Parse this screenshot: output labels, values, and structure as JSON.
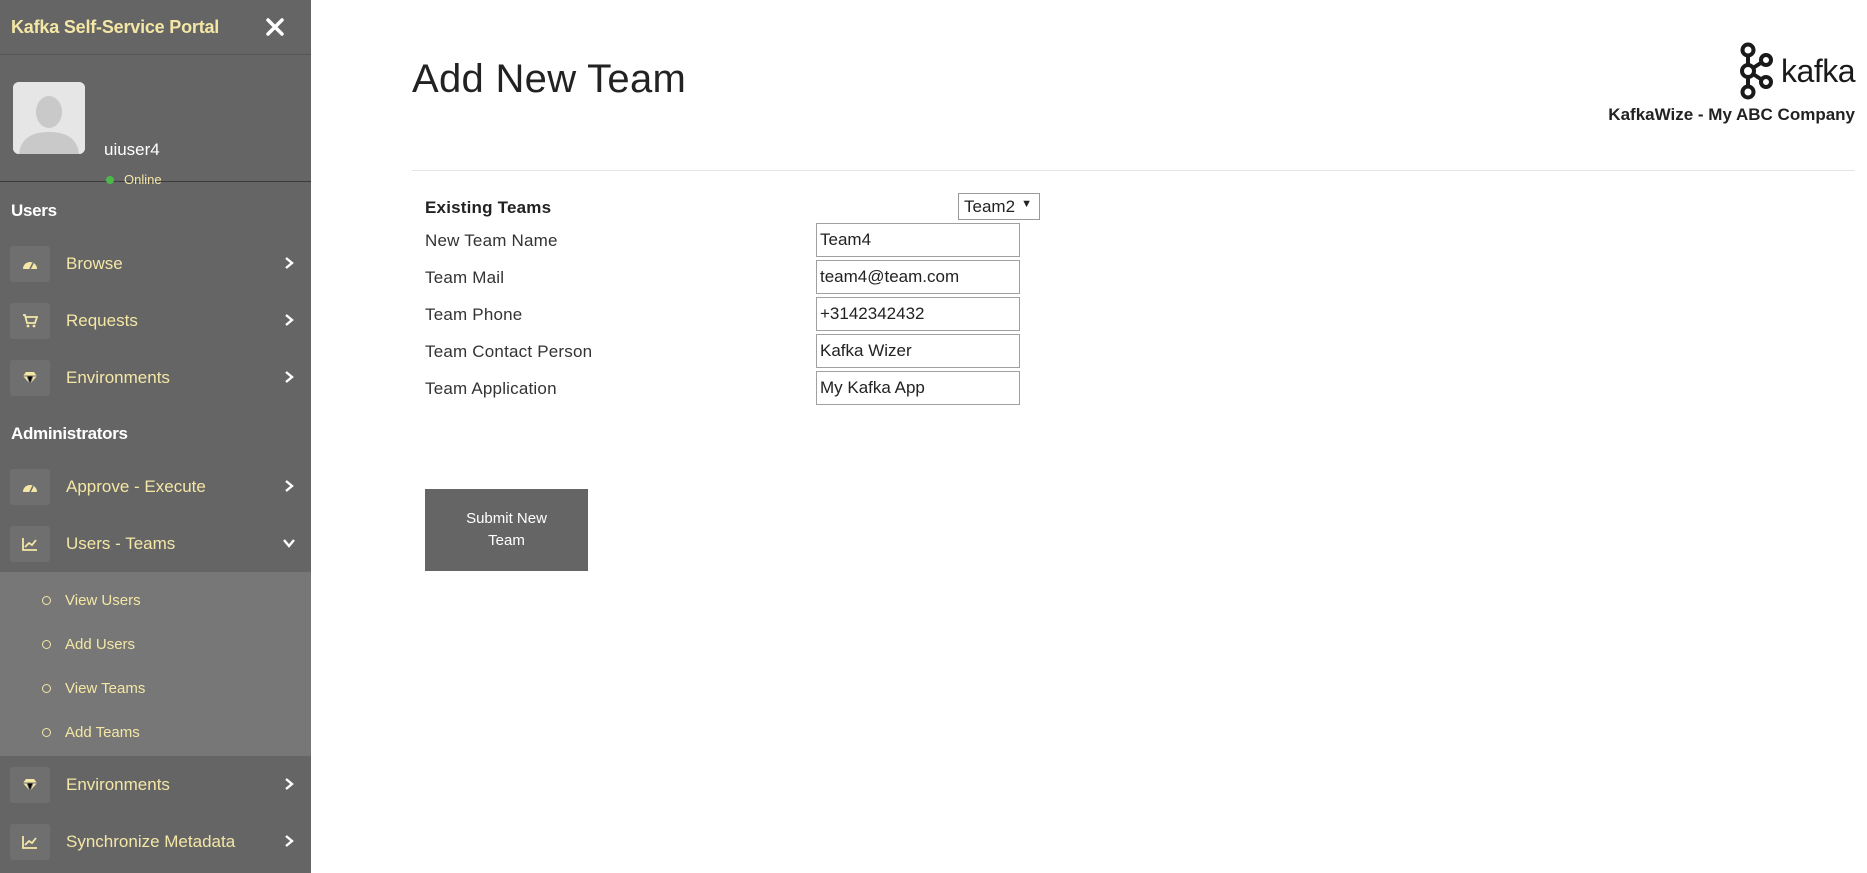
{
  "sidebar": {
    "brand_title": "Kafka Self-Service Portal",
    "user": {
      "name": "uiuser4",
      "status": "Online"
    },
    "sections": {
      "users_header": "Users",
      "admins_header": "Administrators"
    },
    "users_items": [
      {
        "label": "Browse",
        "icon": "dashboard-icon"
      },
      {
        "label": "Requests",
        "icon": "cart-icon"
      },
      {
        "label": "Environments",
        "icon": "diamond-icon"
      }
    ],
    "admin_items": [
      {
        "label": "Approve - Execute",
        "icon": "dashboard-icon"
      },
      {
        "label": "Users - Teams",
        "icon": "chart-icon",
        "expanded": true
      }
    ],
    "sub_items": [
      {
        "label": "View Users"
      },
      {
        "label": "Add Users"
      },
      {
        "label": "View Teams"
      },
      {
        "label": "Add Teams"
      }
    ],
    "admin_items_after": [
      {
        "label": "Environments",
        "icon": "diamond-icon"
      },
      {
        "label": "Synchronize Metadata",
        "icon": "chart-icon"
      }
    ]
  },
  "header": {
    "title": "Add New Team",
    "logo_text": "kafka",
    "company": "KafkaWize - My ABC Company"
  },
  "form": {
    "existing_teams_label": "Existing Teams",
    "existing_teams_selected": "Team2",
    "fields": [
      {
        "label": "New Team Name",
        "value": "Team4"
      },
      {
        "label": "Team Mail",
        "value": "team4@team.com"
      },
      {
        "label": "Team Phone",
        "value": "+3142342432"
      },
      {
        "label": "Team Contact Person",
        "value": "Kafka Wizer"
      },
      {
        "label": "Team Application",
        "value": "My Kafka App"
      }
    ],
    "submit_label": "Submit New Team"
  },
  "colors": {
    "sidebar_bg": "#656565",
    "sidebar_text": "#f4e7a6",
    "submenu_bg": "#777777",
    "online": "#4cb84c"
  }
}
